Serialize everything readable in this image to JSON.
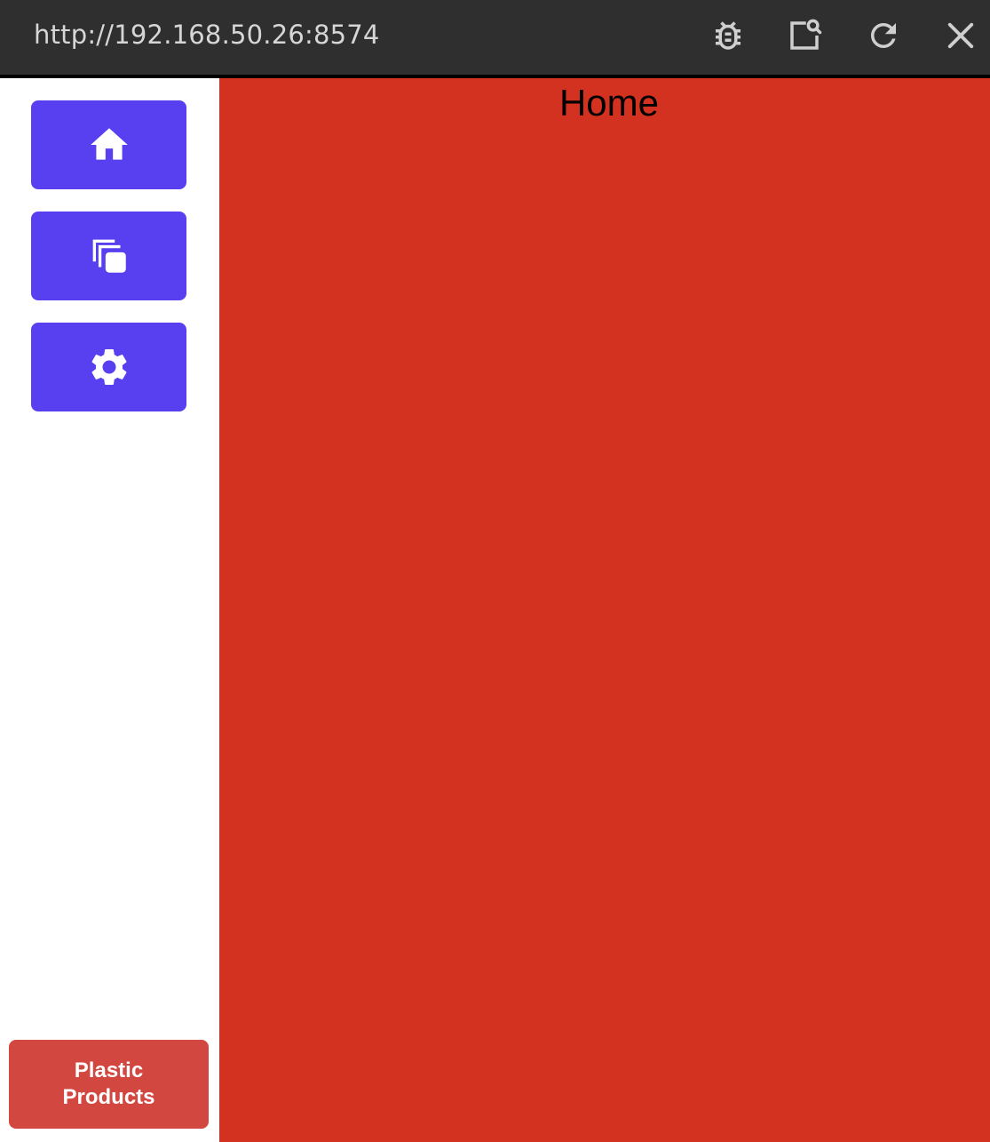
{
  "window": {
    "url": "http://192.168.50.26:8574",
    "controls": [
      {
        "name": "bug-icon"
      },
      {
        "name": "inspect-icon"
      },
      {
        "name": "refresh-icon"
      },
      {
        "name": "close-icon"
      }
    ]
  },
  "sidebar": {
    "items": [
      {
        "name": "sidebar-item-home",
        "icon": "home-icon"
      },
      {
        "name": "sidebar-item-copy",
        "icon": "copy-icon"
      },
      {
        "name": "sidebar-item-settings",
        "icon": "gear-icon"
      }
    ],
    "brand_label": "Plastic Products"
  },
  "main": {
    "title": "Home"
  },
  "colors": {
    "topbar": "#2f2f2f",
    "nav_button": "#583ff0",
    "brand_button": "#d24840",
    "main_background": "#d43220"
  }
}
